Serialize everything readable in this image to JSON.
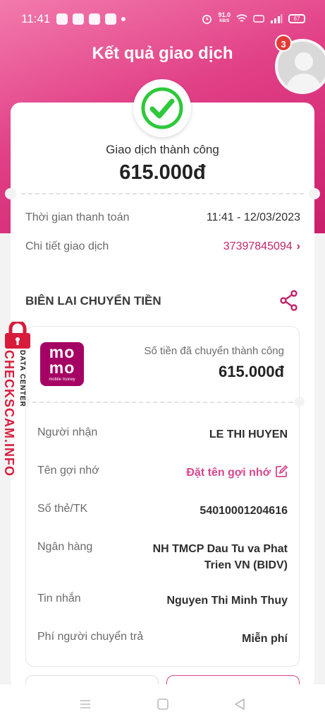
{
  "status_bar": {
    "time": "11:41",
    "network_speed": "91.0",
    "network_unit": "KB/S",
    "battery": "67"
  },
  "header": {
    "title": "Kết quả giao dịch",
    "notification_count": "3"
  },
  "result": {
    "status": "Giao dịch thành công",
    "amount": "615.000đ"
  },
  "payment_info": {
    "time_label": "Thời gian thanh toán",
    "time_value": "11:41 - 12/03/2023",
    "detail_label": "Chi tiết giao dịch",
    "detail_value": "37397845094"
  },
  "receipt": {
    "title": "BIÊN LAI CHUYỂN TIỀN",
    "logo_line1": "mo",
    "logo_line2": "mo",
    "logo_sub": "mobile money",
    "transfer_label": "Số tiền đã chuyển thành công",
    "transfer_amount": "615.000đ",
    "rows": [
      {
        "label": "Người nhận",
        "value": "LE THI HUYEN"
      },
      {
        "label": "Tên gợi nhớ",
        "value": "Đặt tên gợi nhớ"
      },
      {
        "label": "Số thẻ/TK",
        "value": "54010001204616"
      },
      {
        "label": "Ngân hàng",
        "value": "NH TMCP Dau Tu va Phat Trien VN (BIDV)"
      },
      {
        "label": "Tin nhắn",
        "value": "Nguyen Thi Minh Thuy"
      },
      {
        "label": "Phí người chuyển trả",
        "value": "Miễn phí"
      }
    ]
  },
  "watermark": {
    "small": "DATA CENTER",
    "big": "CHECKSCAM.INFO"
  },
  "colors": {
    "brand_pink": "#c2256a",
    "success_green": "#2ec83b",
    "momo_purple": "#a50064"
  }
}
